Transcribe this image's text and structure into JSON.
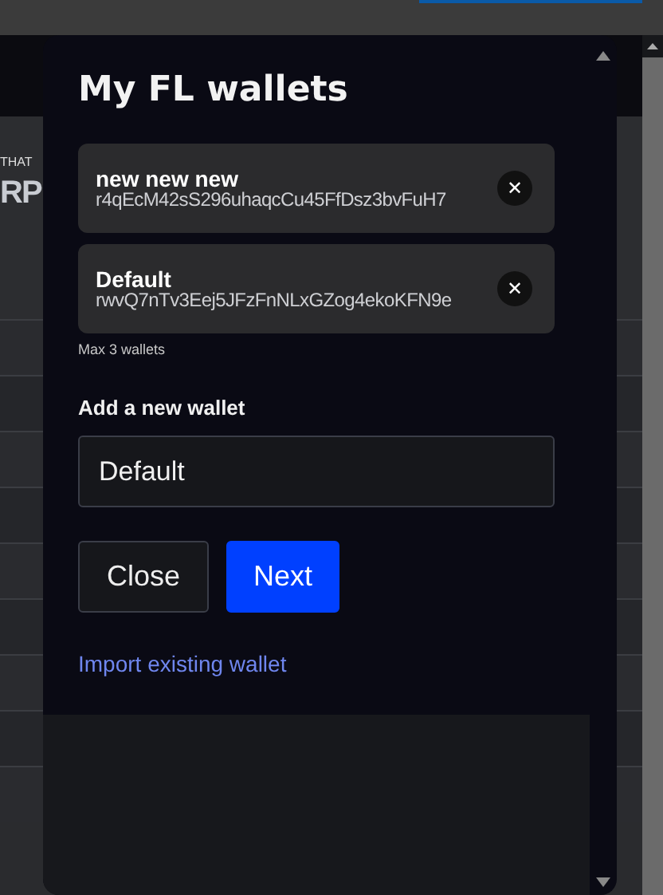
{
  "background_page": {
    "eyebrow": "THAT",
    "heading": "RP"
  },
  "dialog": {
    "title": "My FL wallets",
    "wallets": [
      {
        "name": "new new new",
        "address": "r4qEcM42sS296uhaqcCu45FfDsz3bvFuH7",
        "remove_icon": "✕"
      },
      {
        "name": "Default",
        "address": "rwvQ7nTv3Eej5JFzFnNLxGZog4ekoKFN9e",
        "remove_icon": "✕"
      }
    ],
    "limit_note": "Max 3 wallets",
    "new_wallet_label": "Add a new wallet",
    "new_wallet_value": "Default",
    "buttons": [
      {
        "label": "Close",
        "kind": "secondary"
      },
      {
        "label": "Next",
        "kind": "primary"
      }
    ],
    "link": "Import existing wallet"
  }
}
